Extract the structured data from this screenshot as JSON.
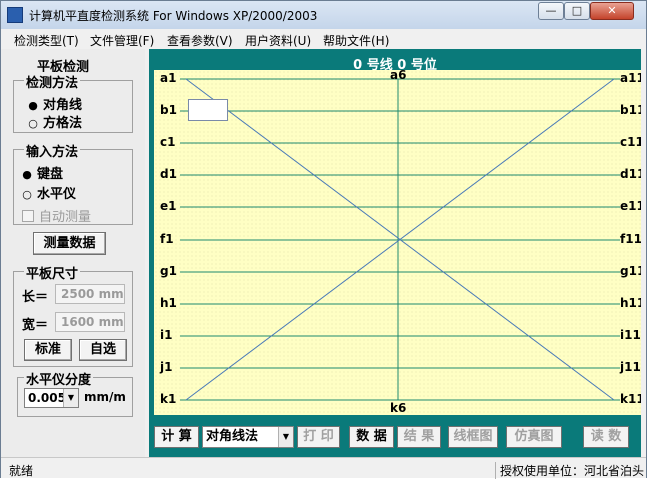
{
  "window": {
    "title": "计算机平直度检测系统   For Windows XP/2000/2003",
    "min_symbol": "—",
    "max_symbol": "□",
    "close_symbol": "✕"
  },
  "menu": [
    "检测类型(T)",
    "文件管理(F)",
    "查看参数(V)",
    "用户资料(U)",
    "帮助文件(H)"
  ],
  "left_panel": {
    "header": "平板检测",
    "method_group": {
      "title": "检测方法",
      "options": [
        {
          "label": "对角线",
          "selected": true
        },
        {
          "label": "方格法",
          "selected": false
        }
      ]
    },
    "input_group": {
      "title": "输入方法",
      "options": [
        {
          "label": "键盘",
          "selected": true
        },
        {
          "label": "水平仪",
          "selected": false
        }
      ],
      "auto_label": "自动测量"
    },
    "measure_button": "测量数据",
    "size_group": {
      "title": "平板尺寸",
      "length_label": "长＝",
      "length_value": "2500 mm",
      "width_label": "宽＝",
      "width_value": "1600 mm",
      "standard_button": "标准",
      "custom_button": "自选"
    },
    "level_group": {
      "title": "水平仪分度",
      "value": "0.005",
      "unit": "mm/m"
    }
  },
  "chart": {
    "title": "0 号线 0 号位",
    "top_center_label": "a6",
    "bottom_center_label": "k6",
    "left_labels": [
      "a1",
      "b1",
      "c1",
      "d1",
      "e1",
      "f1",
      "g1",
      "h1",
      "i1",
      "j1",
      "k1"
    ],
    "right_labels": [
      "a11",
      "b11",
      "c11",
      "d11",
      "e11",
      "f11",
      "g11",
      "h11",
      "i11",
      "j11",
      "k11"
    ],
    "edit_value": ""
  },
  "toolbar": {
    "calc_button": "计 算",
    "method_select": "对角线法",
    "print_button": "打 印",
    "data_button": "数 据",
    "result_button": "结 果",
    "frame_button": "线框图",
    "sim_button": "仿真图",
    "read_button": "读 数"
  },
  "status": {
    "left": "就绪",
    "right": "授权使用单位：河北省泊头"
  },
  "colors": {
    "plot_bg": "#ffffc4",
    "frame_teal": "#0a7a7a",
    "grid_line": "#1e8a6e",
    "diagonal": "#4a7ab8"
  }
}
